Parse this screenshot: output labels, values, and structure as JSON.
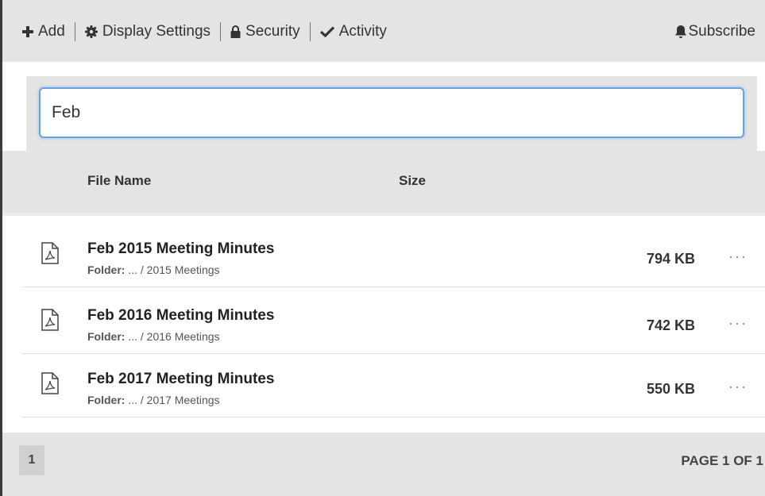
{
  "toolbar": {
    "add_label": "Add",
    "display_settings_label": "Display Settings",
    "security_label": "Security",
    "activity_label": "Activity",
    "subscribe_label": "Subscribe"
  },
  "search": {
    "value": "Feb"
  },
  "table": {
    "columns": [
      "File Name",
      "Size"
    ]
  },
  "files": [
    {
      "title": "Feb 2015 Meeting Minutes",
      "folder_label": "Folder:",
      "folder_path": " ... / 2015 Meetings",
      "size": "794 KB",
      "more": "···"
    },
    {
      "title": "Feb 2016 Meeting Minutes",
      "folder_label": "Folder:",
      "folder_path": " ... / 2016 Meetings",
      "size": "742 KB",
      "more": "···"
    },
    {
      "title": "Feb 2017 Meeting Minutes",
      "folder_label": "Folder:",
      "folder_path": " ... / 2017 Meetings",
      "size": "550 KB",
      "more": "···"
    }
  ],
  "pagination": {
    "current_page": "1",
    "page_info": "PAGE 1 OF 1"
  },
  "colors": {
    "toolbar_bg": "#e4e4e4",
    "search_focus_border": "#66a3e3",
    "row_divider": "#e2e2e2"
  },
  "icons": {
    "add": "plus-icon",
    "display_settings": "gear-icon",
    "security": "lock-icon",
    "activity": "checkmark-icon",
    "subscribe": "bell-icon",
    "file": "pdf-file-icon"
  }
}
